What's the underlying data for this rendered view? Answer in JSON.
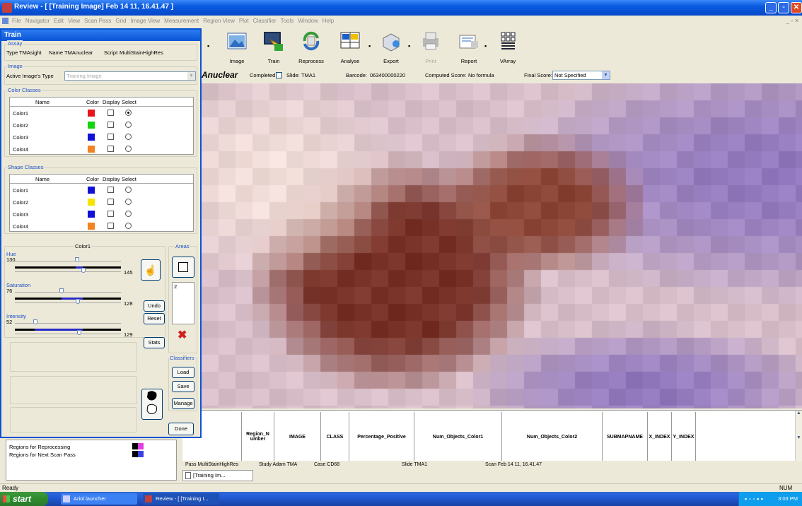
{
  "window": {
    "title": "Review - [ [Training Image] Feb 14 11, 16.41.47 ]"
  },
  "menu": [
    "File",
    "Navigator",
    "Edit",
    "View",
    "Scan Pass",
    "Grid",
    "Image View",
    "Measurement",
    "Region View",
    "Plot",
    "Classifier",
    "Tools",
    "Window",
    "Help"
  ],
  "toolbar": {
    "image": "Image",
    "train": "Train",
    "reprocess": "Reprocess",
    "analyse": "Analyse",
    "export": "Export",
    "print": "Print",
    "report": "Report",
    "varray": "VArray"
  },
  "infobar": {
    "assay": "Anuclear",
    "completed_label": "Completed",
    "slide_label": "Slide:",
    "slide": "TMA1",
    "barcode_label": "Barcode:",
    "barcode": "063400000220",
    "computed_label": "Computed Score:",
    "computed": "No formula",
    "final_label": "Final Score:",
    "final_value": "Not Specified"
  },
  "train": {
    "title": "Train",
    "assay_label": "Assay",
    "type_label": "Type",
    "type_value": "TMAsight",
    "name_label": "Name",
    "name_value": "TMAnuclear",
    "script_label": "Script",
    "script_value": "MultiStainHighRes",
    "image_label": "Image",
    "active_type_label": "Active Image's Type",
    "active_type_value": "Training Image",
    "color_classes_label": "Color Classes",
    "shape_classes_label": "Shape Classes",
    "col_name": "Name",
    "col_color": "Color",
    "col_display": "Display",
    "col_select": "Select",
    "color_classes": [
      {
        "name": "Color1",
        "color": "#e8141b",
        "selected": true
      },
      {
        "name": "Color2",
        "color": "#12d40e",
        "selected": false
      },
      {
        "name": "Color3",
        "color": "#1010d8",
        "selected": false
      },
      {
        "name": "Color4",
        "color": "#f58220",
        "selected": false
      }
    ],
    "shape_classes": [
      {
        "name": "Color1",
        "color": "#1010d8",
        "selected": false
      },
      {
        "name": "Color2",
        "color": "#f5e400",
        "selected": false
      },
      {
        "name": "Color3",
        "color": "#1010d8",
        "selected": false
      },
      {
        "name": "Color4",
        "color": "#f58220",
        "selected": false
      }
    ],
    "current_class": "Color1",
    "hue_label": "Hue",
    "hue_value": "130",
    "hue_max": "145",
    "saturation_label": "Saturation",
    "saturation_value": "76",
    "saturation_max": "128",
    "intensity_label": "Intensity",
    "intensity_value": "52",
    "intensity_max": "129",
    "areas_label": "Areas",
    "areas_count": "2",
    "undo": "Undo",
    "reset": "Reset",
    "stats": "Stats",
    "classifiers_label": "Classifiers",
    "load": "Load",
    "save": "Save",
    "manage": "Manage",
    "done": "Done"
  },
  "table": {
    "columns": [
      "Region_N umber",
      "IMAGE",
      "CLASS",
      "Percentage_Positive",
      "Num_Objects_Color1",
      "Num_Objects_Color2",
      "SUBMAPNAME",
      "X_INDEX",
      "Y_INDEX"
    ]
  },
  "status_row": {
    "pass": "Pass MultiStainHighRes",
    "study": "Study Adam TMA",
    "case": "Case CD68",
    "slide": "Slide TMA1",
    "scan": "Scan Feb 14 11, 16.41.47"
  },
  "doc_tab": "[Training Im...",
  "regions": {
    "reprocessing": "Regions for Reprocessing",
    "next_scan": "Regions for Next Scan Pass"
  },
  "statusbar": {
    "left": "Ready",
    "right": "NUM"
  },
  "taskbar": {
    "start": "start",
    "task1": "Ariol launcher",
    "task2": "Review - [ [Training I...",
    "clock": "3:03 PM"
  }
}
